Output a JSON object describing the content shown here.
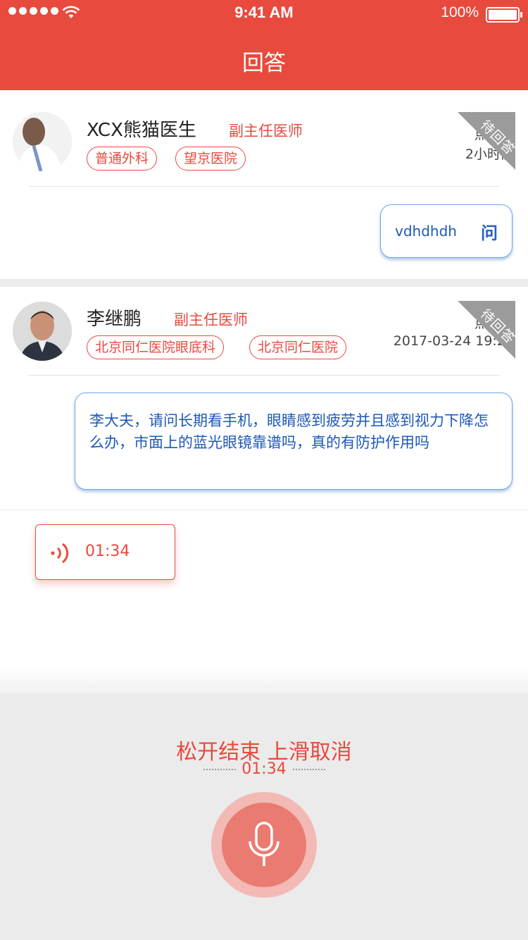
{
  "status_bar": {
    "time": "9:41 AM",
    "battery": "100%"
  },
  "header": {
    "title": "回答"
  },
  "colors": {
    "accent": "#e84a3d",
    "question_text": "#1d58b8",
    "badge": "#9b9b9b"
  },
  "questions": [
    {
      "doctor_name": "XCX熊猫医生",
      "doctor_title": "副主任医师",
      "tags": [
        "普通外科",
        "望京医院"
      ],
      "meta_line1": "点击 0",
      "meta_line2": "2小时前",
      "status_badge": "待回答",
      "question": "vdhdhdh",
      "question_mark": "问"
    },
    {
      "doctor_name": "李继鹏",
      "doctor_title": "副主任医师",
      "tags": [
        "北京同仁医院眼底科",
        "北京同仁医院"
      ],
      "meta_line1": "点击 0",
      "meta_line2": "2017-03-24 19:21",
      "status_badge": "待回答",
      "question": "李大夫，请问长期看手机，眼睛感到疲劳并且感到视力下降怎么办，市面上的蓝光眼镜靠谱吗，真的有防护作用吗"
    }
  ],
  "voice_message": {
    "duration": "01:34",
    "icon": "sound-wave-icon"
  },
  "recording": {
    "hint": "松开结束 上滑取消",
    "timer": "01:34",
    "icon": "microphone-icon"
  }
}
